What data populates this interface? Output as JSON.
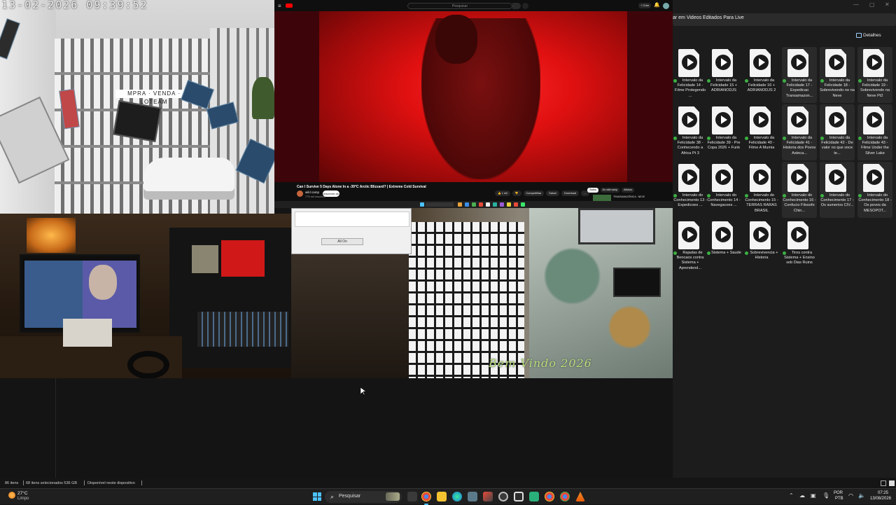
{
  "camera_top_left": {
    "timestamp": "13-02-2026 09:39:52",
    "sign_text": "MPRA · VENDA · LOTEAM"
  },
  "youtube": {
    "search_placeholder": "Pesquisar",
    "create_label": "+ Criar",
    "video_title": "Can I Survive 5 Days Alone In a -39°C Arctic Blizzard? | Extreme Cold Survival",
    "channel": "wild camp",
    "subscribers": "775 mil inscritos",
    "subscribe_label": "Inscrever-se",
    "actions": [
      "👍 1 mil",
      "👎",
      "Compartilhar",
      "Salvar",
      "Download",
      "…"
    ],
    "chips": [
      "Todos",
      "Do wild camp",
      "Alheios"
    ],
    "recommended_title": "TRANSAMAZÔNICA · NEVE"
  },
  "camera_hallway": {
    "dialog_button": "All On",
    "overlay_text": "Bem Vindo 2026"
  },
  "explorer": {
    "address": "ar em Videos Editados Para Live",
    "details_label": "Detalhes",
    "files": [
      {
        "name": "Intervalo da Felicidade 14 - Filme Protegendo ...",
        "selected": false
      },
      {
        "name": "Intervalo da Felicidade 15 + ADRIANODJS",
        "selected": false
      },
      {
        "name": "Intervalo da Felicidade 16 + ADRIANODJS 2",
        "selected": false
      },
      {
        "name": "Intervalo da Felicidade 17 - Expedicao Transamazon...",
        "selected": true
      },
      {
        "name": "Intervalo da Felicidade 18 - Sobrevivendo no na Neve",
        "selected": true
      },
      {
        "name": "Intervalo da Felicidade 19 - Sobrevivendo na Neve Pt2",
        "selected": true
      },
      {
        "name": "Intervalo da Felicidade 38 - Conhecendo a Africa Pt 3",
        "selected": false
      },
      {
        "name": "Intervalo da Felicidade 39 - Pre Copa 2026 + Funk",
        "selected": false
      },
      {
        "name": "Intervalo da Felicidade 40 - Filme A Mumia",
        "selected": false
      },
      {
        "name": "Intervalo da Felicidade 41 - Historia dos Povos Asteca...",
        "selected": true
      },
      {
        "name": "Intervalo da Felicidade 42 - De valor no que voce te...",
        "selected": true
      },
      {
        "name": "Intervalo da Felicidade 43 - Filme Under the Silver Lake",
        "selected": true
      },
      {
        "name": "Intervalo do Conhecimento 13 - Expedicoes ...",
        "selected": false
      },
      {
        "name": "Intervalo do Conhecimento 14 - Navegacoes ...",
        "selected": false
      },
      {
        "name": "Intervalo do Conhecimento 15 - TERRAS RARAS BRASIL",
        "selected": false
      },
      {
        "name": "Intervalo do Conhecimento 16 - Confucio Filosofo Chin...",
        "selected": true
      },
      {
        "name": "Intervalo do Conhecimento 17 - Os sumerios CIV...",
        "selected": true
      },
      {
        "name": "Intervalo do Conhecimento 18 - Os povos da MESOPOT...",
        "selected": true
      },
      {
        "name": "Rajadas de Bencaos contra Sistema + Aprendend...",
        "selected": false
      },
      {
        "name": "Sistema + Saude",
        "selected": false
      },
      {
        "name": "Sobrevivencia + Historia",
        "selected": false
      },
      {
        "name": "Tiros contra Sistema + Ensino sob Dias Ruins",
        "selected": false
      }
    ]
  },
  "status_bar": {
    "items": "86 itens",
    "selected": "68 itens selecionados  536 GB",
    "availability": "Disponível neste dispositivo"
  },
  "taskbar": {
    "temperature": "27°C",
    "condition": "Limpo",
    "search_label": "Pesquisar",
    "lang_top": "POR",
    "lang_bottom": "PTB",
    "time": "07:25",
    "date": "13/08/2026"
  },
  "colors": {
    "taskbar_accent": "#4cc2ff",
    "youtube_red": "#ff0000",
    "sync_green": "#3cb043",
    "overlay_text": "#b9e07a"
  }
}
